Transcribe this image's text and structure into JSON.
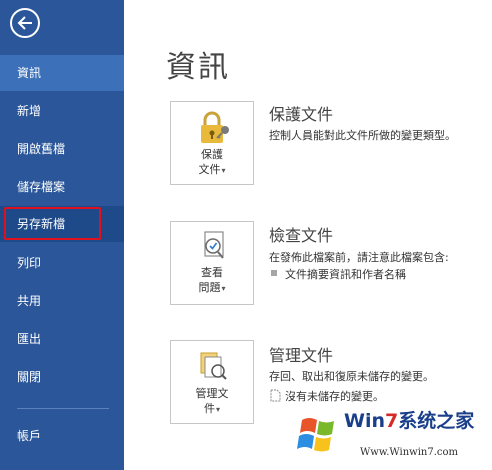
{
  "sidebar": {
    "items": [
      {
        "label": "資訊"
      },
      {
        "label": "新增"
      },
      {
        "label": "開啟舊檔"
      },
      {
        "label": "儲存檔案"
      },
      {
        "label": "另存新檔"
      },
      {
        "label": "列印"
      },
      {
        "label": "共用"
      },
      {
        "label": "匯出"
      },
      {
        "label": "關閉"
      },
      {
        "label": "帳戶"
      }
    ]
  },
  "main": {
    "title": "資訊",
    "sections": [
      {
        "button_line1": "保護",
        "button_line2": "文件",
        "title": "保護文件",
        "description": "控制人員能對此文件所做的變更類型。"
      },
      {
        "button_line1": "查看",
        "button_line2": "問題",
        "title": "檢查文件",
        "description": "在發佈此檔案前，請注意此檔案包含:",
        "subitem": "文件摘要資訊和作者名稱"
      },
      {
        "button_line1": "管理文",
        "button_line2": "件",
        "title": "管理文件",
        "description": "存回、取出和復原未儲存的變更。",
        "subitem": "沒有未儲存的變更。"
      }
    ]
  },
  "watermark": {
    "text_win": "Win",
    "text_7": "7",
    "text_rest": "系统之家",
    "url": "Www.Winwin7.com"
  }
}
